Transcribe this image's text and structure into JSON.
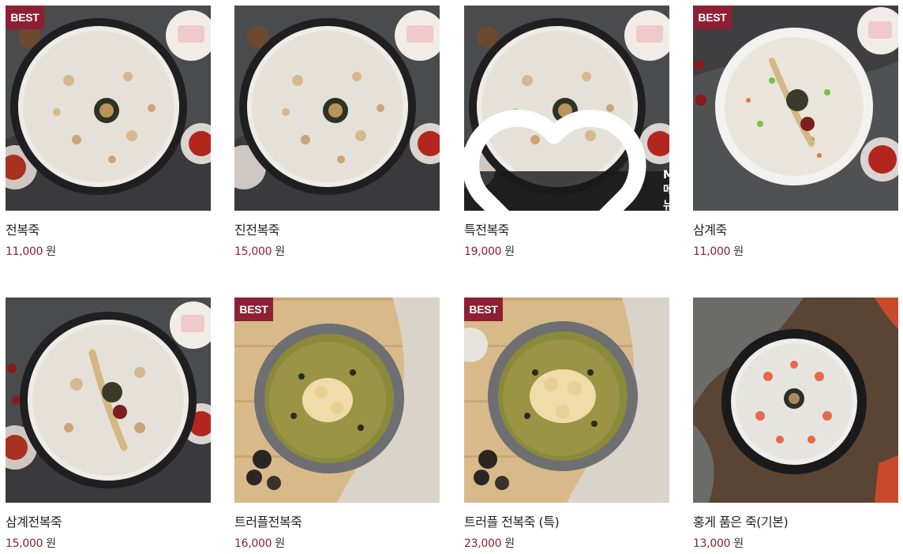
{
  "colors": {
    "accent": "#8e1f34",
    "text": "#222222"
  },
  "products": [
    {
      "name": "전복죽",
      "price": "11,000",
      "unit": "원",
      "best": "BEST",
      "theme": "abalone-gray"
    },
    {
      "name": "진전복죽",
      "price": "15,000",
      "unit": "원",
      "theme": "abalone-gray"
    },
    {
      "name": "특전복죽",
      "price": "19,000",
      "unit": "원",
      "theme": "abalone-gray",
      "my_menu": "MY메뉴"
    },
    {
      "name": "삼계죽",
      "price": "11,000",
      "unit": "원",
      "best": "BEST",
      "theme": "samgye-white"
    },
    {
      "name": "삼계전복죽",
      "price": "15,000",
      "unit": "원",
      "theme": "samgye-dark"
    },
    {
      "name": "트러플전복죽",
      "price": "16,000",
      "unit": "원",
      "best": "BEST",
      "theme": "truffle-wood"
    },
    {
      "name": "트러플 전복죽 (특)",
      "price": "23,000",
      "unit": "원",
      "best": "BEST",
      "theme": "truffle-wood"
    },
    {
      "name": "홍게 품은 죽(기본)",
      "price": "13,000",
      "unit": "원",
      "theme": "crab-dark"
    }
  ]
}
